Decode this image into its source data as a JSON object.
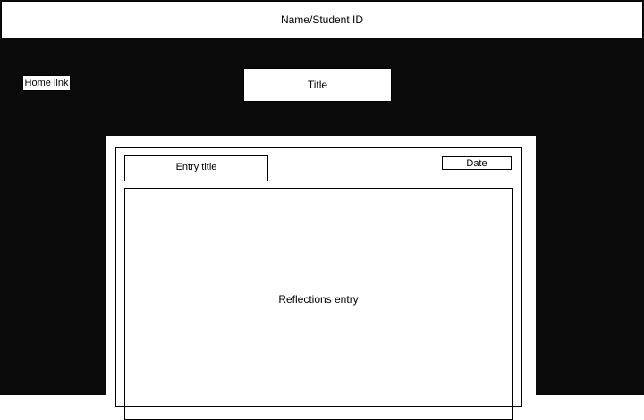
{
  "header": {
    "text": "Name/Student ID"
  },
  "nav": {
    "home_link": "Home link"
  },
  "page": {
    "title": "Title"
  },
  "entry": {
    "title": "Entry title",
    "date": "Date",
    "body": "Reflections entry"
  },
  "colors": {
    "background": "#0a0a0a",
    "panel": "#ffffff",
    "border": "#000000"
  }
}
